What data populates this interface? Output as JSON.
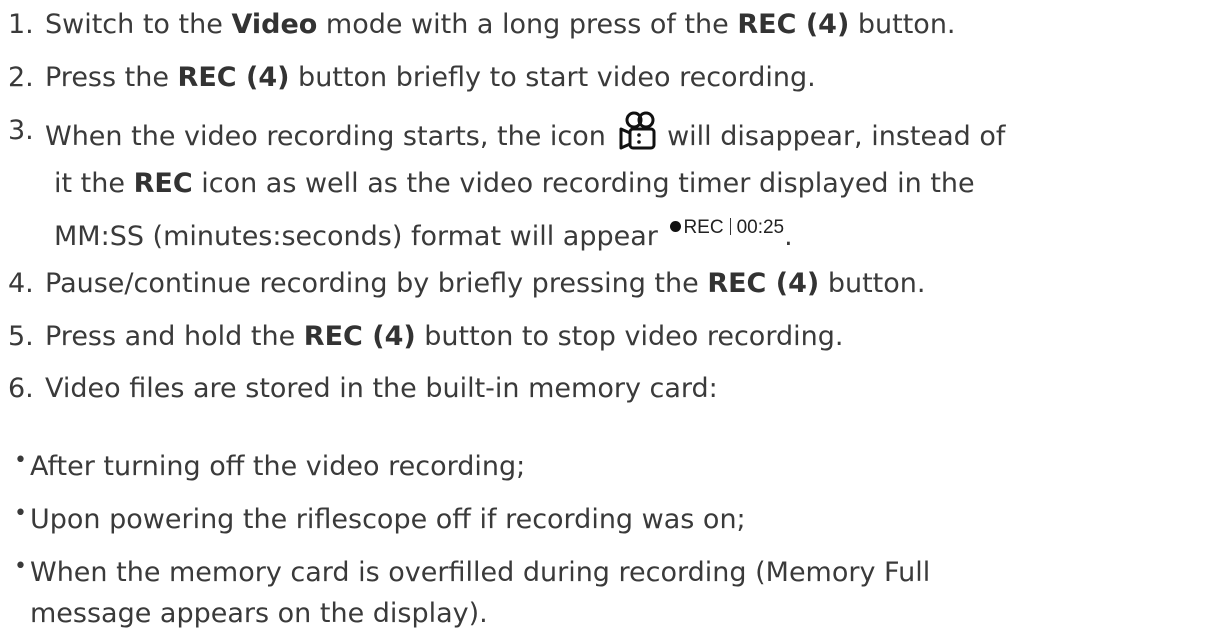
{
  "steps": [
    {
      "num": "1.",
      "parts": [
        {
          "text": "Switch to the "
        },
        {
          "text": "Video",
          "bold": true
        },
        {
          "text": " mode with a long press of the "
        },
        {
          "text": "REC (4)",
          "bold": true
        },
        {
          "text": " button."
        }
      ]
    },
    {
      "num": "2.",
      "parts": [
        {
          "text": "Press the "
        },
        {
          "text": "REC (4)",
          "bold": true
        },
        {
          "text": " button briefly to start video recording."
        }
      ]
    },
    {
      "num": "3.",
      "line1_before_icon": "When the video recording starts, the icon ",
      "line1_after_icon": " will disappear, instead of",
      "line2_pre": "it the ",
      "line2_bold": "REC",
      "line2_post": " icon as well as the video recording timer displayed in the",
      "line3_pre": "MM:SS (minutes:seconds) format will appear ",
      "line3_post": ".",
      "camera_icon": "video-camera-icon",
      "rec_indicator": {
        "label": "REC",
        "time": "00:25"
      }
    },
    {
      "num": "4.",
      "parts": [
        {
          "text": "Pause/continue recording by briefly pressing the "
        },
        {
          "text": "REC (4)",
          "bold": true
        },
        {
          "text": " button."
        }
      ]
    },
    {
      "num": "5.",
      "parts": [
        {
          "text": "Press and hold the "
        },
        {
          "text": "REC (4)",
          "bold": true
        },
        {
          "text": " button to stop video recording."
        }
      ]
    },
    {
      "num": "6.",
      "parts": [
        {
          "text": "Video files are stored in the built-in memory card:"
        }
      ]
    }
  ],
  "bullet_glyph": "•",
  "bullets": [
    [
      "After turning off the video recording;"
    ],
    [
      "Upon powering the riflescope off if recording was on;"
    ],
    [
      "When the memory card is overfilled during recording (Memory Full",
      "message appears on the display)."
    ]
  ],
  "colors": {
    "text": "#3a3a3a",
    "bold_text": "#333333"
  }
}
